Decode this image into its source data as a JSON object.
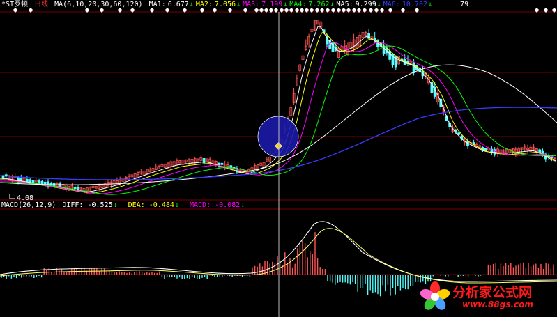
{
  "header": {
    "stock_name": "*ST罗顿",
    "period": "日线",
    "ma_params": "MA(6,10,20,30,60,120)",
    "ma_values": [
      {
        "label": "MA1:",
        "value": "6.677",
        "color": "#ffffff"
      },
      {
        "label": "MA2:",
        "value": "7.056",
        "color": "#ffff00"
      },
      {
        "label": "MA3:",
        "value": "7.199",
        "color": "#ff00ff"
      },
      {
        "label": "MA4:",
        "value": "7.262",
        "color": "#00ff00"
      },
      {
        "label": "MA5:",
        "value": "9.299",
        "color": "#ffffff"
      },
      {
        "label": "MA6:",
        "value": "10.702",
        "color": "#3a3aff"
      }
    ],
    "date_fragment": "79"
  },
  "macd_header": {
    "params": "MACD(26,12,9)",
    "diff_label": "DIFF:",
    "diff_value": "-0.525",
    "dea_label": "DEA:",
    "dea_value": "-0.484",
    "macd_label": "MACD:",
    "macd_value": "-0.082"
  },
  "price_labels": {
    "low_label": "4.08"
  },
  "colors": {
    "background": "#000000",
    "up_candle": "#ff5555",
    "down_candle": "#54ffff",
    "ma1": "#ffffff",
    "ma2": "#ffff00",
    "ma3": "#ff00ff",
    "ma4": "#00ff00",
    "ma5": "#ffffff",
    "ma6": "#3a3aff",
    "grid": "#8b0000",
    "circle_fill": "#1a1aa8",
    "marker": "#ffd700"
  },
  "watermark": {
    "text": "分析家公式网",
    "url": "www.88gs.com"
  }
}
